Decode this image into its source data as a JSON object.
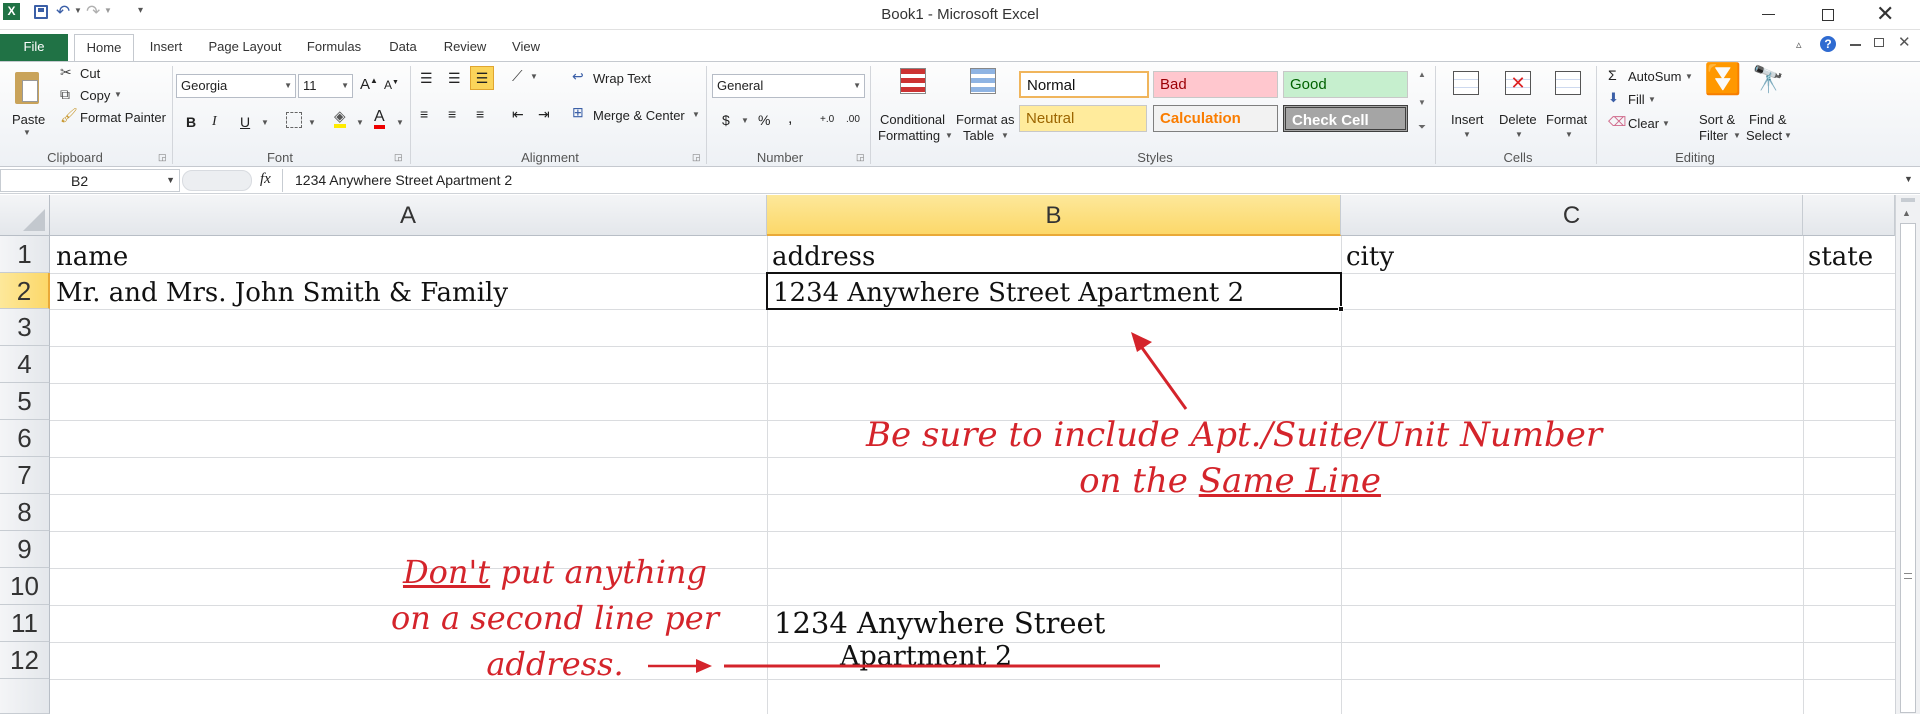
{
  "window": {
    "title": "Book1 - Microsoft Excel"
  },
  "tabs": {
    "file": "File",
    "home": "Home",
    "insert": "Insert",
    "page_layout": "Page Layout",
    "formulas": "Formulas",
    "data": "Data",
    "review": "Review",
    "view": "View"
  },
  "clipboard": {
    "paste": "Paste",
    "cut": "Cut",
    "copy": "Copy",
    "format_painter": "Format Painter",
    "label": "Clipboard"
  },
  "font": {
    "name": "Georgia",
    "size": "11",
    "label": "Font"
  },
  "alignment": {
    "wrap_text": "Wrap Text",
    "merge_center": "Merge & Center",
    "label": "Alignment"
  },
  "number": {
    "format": "General",
    "label": "Number"
  },
  "styles": {
    "conditional_1": "Conditional",
    "conditional_2": "Formatting",
    "format_as_1": "Format as",
    "format_as_2": "Table",
    "normal": "Normal",
    "bad": "Bad",
    "good": "Good",
    "neutral": "Neutral",
    "calculation": "Calculation",
    "check_cell": "Check Cell",
    "label": "Styles"
  },
  "cells_group": {
    "insert": "Insert",
    "delete": "Delete",
    "format": "Format",
    "label": "Cells"
  },
  "editing": {
    "autosum": "AutoSum",
    "fill": "Fill",
    "clear": "Clear",
    "sort_1": "Sort &",
    "sort_2": "Filter",
    "find_1": "Find &",
    "find_2": "Select",
    "label": "Editing"
  },
  "formula_bar": {
    "name_box": "B2",
    "fx": "fx",
    "content": "1234 Anywhere Street Apartment 2"
  },
  "sheet": {
    "columns": [
      "A",
      "B",
      "C"
    ],
    "rows": [
      "1",
      "2",
      "3",
      "4",
      "5",
      "6",
      "7",
      "8",
      "9",
      "10",
      "11",
      "12"
    ],
    "a1": "name",
    "b1": "address",
    "c1": "city",
    "d1": "state",
    "a2": "Mr. and Mrs. John Smith & Family",
    "b2": "1234 Anywhere Street Apartment 2",
    "b11": "1234 Anywhere Street",
    "b12": "Apartment 2"
  },
  "annotations": {
    "top_line1": "Be sure to include Apt./Suite/Unit Number",
    "top_line2_a": "on the",
    "top_line2_b": "Same Line",
    "left_line1_a": "Don't",
    "left_line1_b": "put anything",
    "left_line2": "on a second line per",
    "left_line3": "address."
  },
  "colors": {
    "excel_green": "#207245",
    "accent_red": "#d4242b",
    "selected_header": "#fcd86a"
  }
}
